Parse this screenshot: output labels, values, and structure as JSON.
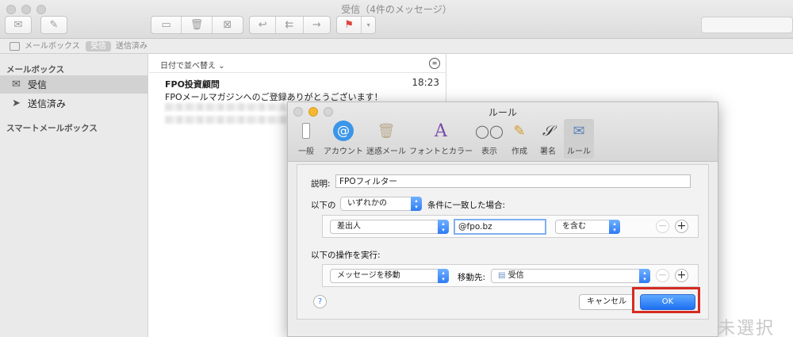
{
  "window": {
    "title": "受信（4件のメッセージ）"
  },
  "favorites": {
    "mailboxes": "メールボックス",
    "inbox": "受信",
    "sent": "送信済み"
  },
  "sidebar": {
    "header": "メールボックス",
    "items": [
      {
        "label": "受信",
        "icon": "inbox-tray-icon"
      },
      {
        "label": "送信済み",
        "icon": "paper-plane-icon"
      }
    ],
    "smart_header": "スマートメールボックス"
  },
  "message_list": {
    "sort_label": "日付で並べ替え",
    "messages": [
      {
        "sender": "FPO投資顧問",
        "time": "18:23",
        "subject": "FPOメールマガジンへのご登録ありがとうございます！"
      }
    ]
  },
  "rules_sheet": {
    "title": "ルール",
    "tabs": [
      {
        "label": "一般",
        "icon": "switch-icon"
      },
      {
        "label": "アカウント",
        "icon": "at-sign-icon"
      },
      {
        "label": "迷惑メール",
        "icon": "junk-trash-icon"
      },
      {
        "label": "フォントとカラー",
        "icon": "font-color-icon"
      },
      {
        "label": "表示",
        "icon": "glasses-icon"
      },
      {
        "label": "作成",
        "icon": "pencil-icon"
      },
      {
        "label": "署名",
        "icon": "signature-icon"
      },
      {
        "label": "ルール",
        "icon": "rules-envelope-icon"
      }
    ],
    "description_label": "説明:",
    "description_value": "FPOフィルター",
    "condition_prefix": "以下の",
    "condition_mode": "いずれかの",
    "condition_suffix": "条件に一致した場合:",
    "condition": {
      "field": "差出人",
      "value": "@fpo.bz",
      "operator": "を含む"
    },
    "action_label": "以下の操作を実行:",
    "action": {
      "type": "メッセージを移動",
      "target_label": "移動先:",
      "target": "受信"
    },
    "help_label": "?",
    "cancel_label": "キャンセル",
    "ok_label": "OK"
  },
  "overlay": {
    "watermark": "未選択"
  },
  "colors": {
    "accent": "#2f7cf5",
    "highlight": "#d62b22"
  }
}
